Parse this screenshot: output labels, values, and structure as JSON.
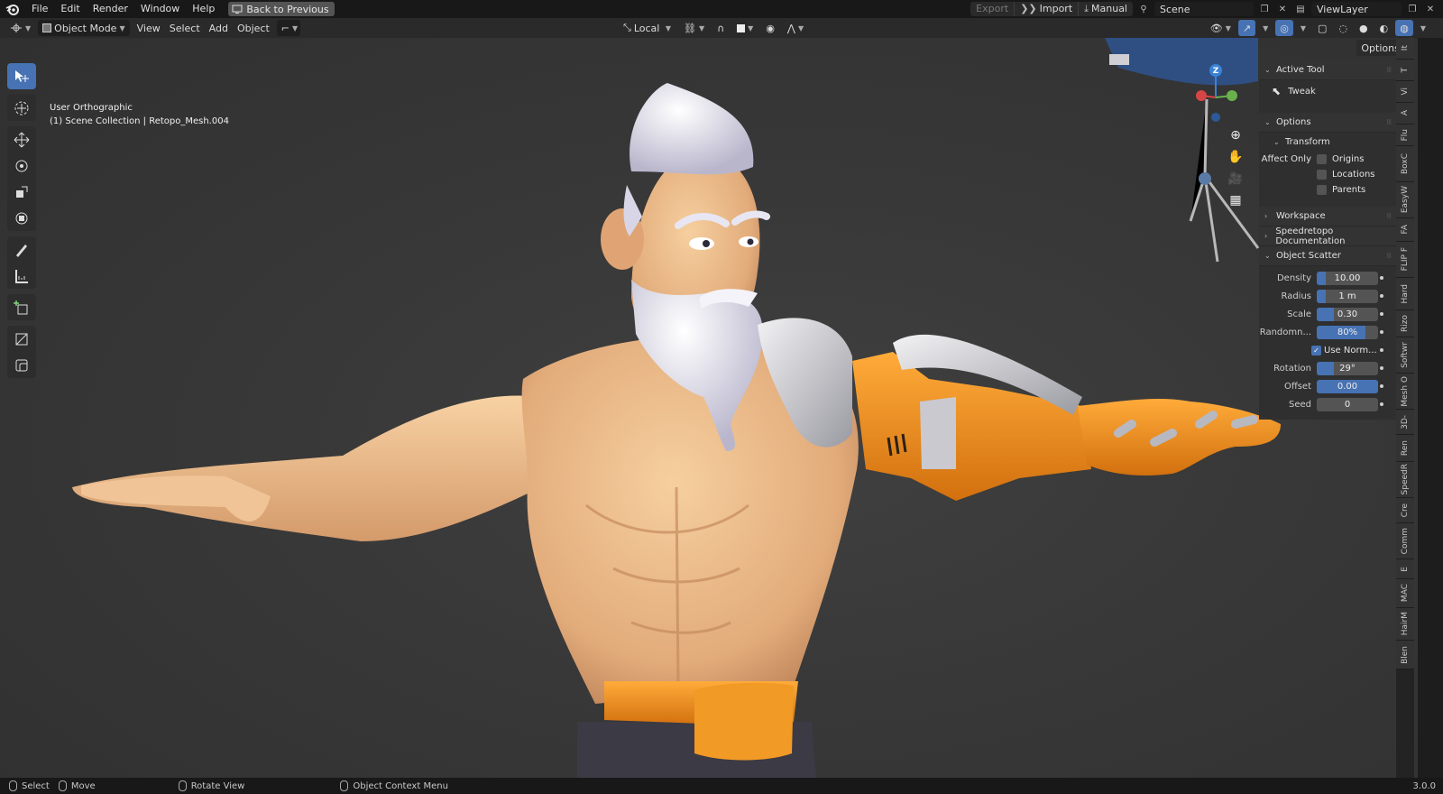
{
  "topbar": {
    "menus": [
      "File",
      "Edit",
      "Render",
      "Window",
      "Help"
    ],
    "back_label": "Back to Previous",
    "export_label": "Export",
    "import_label": "Import",
    "manual_label": "Manual",
    "scene_value": "Scene",
    "viewlayer_value": "ViewLayer"
  },
  "header": {
    "mode": "Object Mode",
    "menus": [
      "View",
      "Select",
      "Add",
      "Object"
    ],
    "transform_orientation": "Local",
    "options_label": "Options"
  },
  "viewport": {
    "view_name": "User Orthographic",
    "collection_line": "(1) Scene Collection | Retopo_Mesh.004",
    "gizmo_axis": "Z"
  },
  "npanel": {
    "active_tool_header": "Active Tool",
    "active_tool": "Tweak",
    "options_header": "Options",
    "transform_header": "Transform",
    "affect_only_label": "Affect Only",
    "affect_only": [
      "Origins",
      "Locations",
      "Parents"
    ],
    "workspace_header": "Workspace",
    "speedretopo_header": "Speedretopo Documentation",
    "scatter_header": "Object Scatter",
    "scatter": {
      "density_label": "Density",
      "density_value": "10.00",
      "radius_label": "Radius",
      "radius_value": "1 m",
      "scale_label": "Scale",
      "scale_value": "0.30",
      "random_label": "Randomn...",
      "random_value": "80%",
      "random_fill": 0.8,
      "use_normal_label": "Use Norm...",
      "rotation_label": "Rotation",
      "rotation_value": "29°",
      "offset_label": "Offset",
      "offset_value": "0.00",
      "seed_label": "Seed",
      "seed_value": "0"
    }
  },
  "vtabs": [
    "It",
    "T",
    "Vi",
    "A",
    "Flu",
    "BoxC",
    "EasyW",
    "FA",
    "FLIP F",
    "Hard",
    "Rizo",
    "Softwr",
    "Mesh O",
    "3D-",
    "Ren",
    "SpeedR",
    "Cre",
    "Comm",
    "E",
    "MAC",
    "HairM",
    "Blen"
  ],
  "status": {
    "select_label": "Select",
    "move_label": "Move",
    "rotate_label": "Rotate View",
    "context_label": "Object Context Menu",
    "version": "3.0.0"
  },
  "colors": {
    "accent": "#4772b3",
    "background": "#383838",
    "skin": "#e9b98c",
    "armor_orange": "#f0901e"
  }
}
